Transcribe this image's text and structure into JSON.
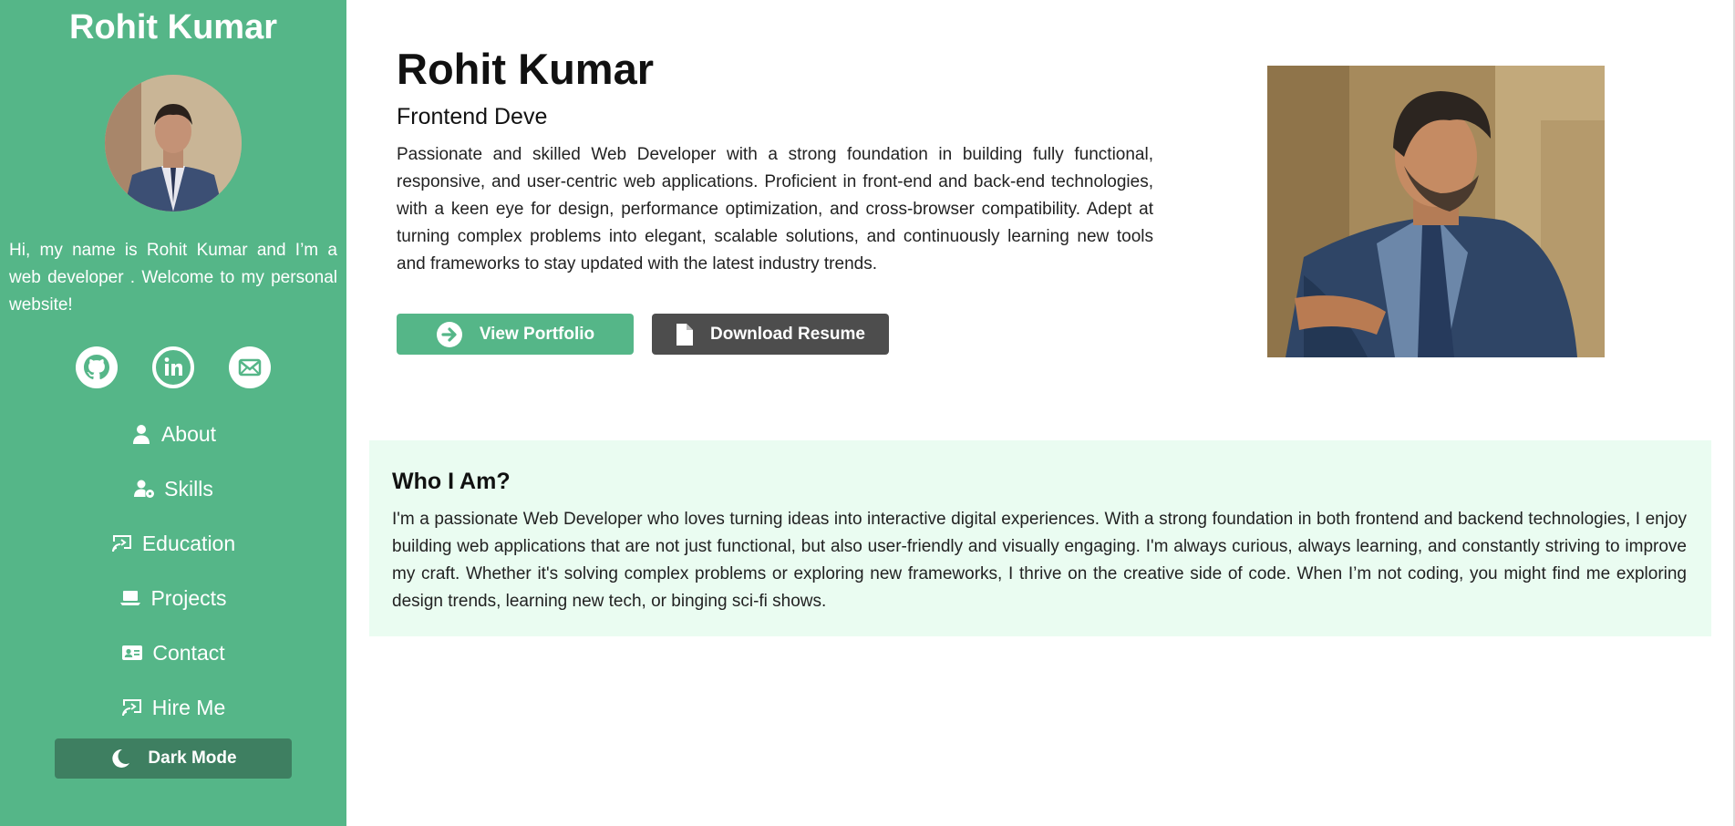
{
  "sidebar": {
    "name": "Rohit Kumar",
    "intro": "Hi, my name is Rohit Kumar and I’m a web developer . Welcome to my personal website!",
    "socials": [
      "github-icon",
      "linkedin-icon",
      "mail-icon"
    ],
    "nav": [
      {
        "label": "About",
        "icon": "user-icon"
      },
      {
        "label": "Skills",
        "icon": "user-gear-icon"
      },
      {
        "label": "Education",
        "icon": "chalkboard-icon"
      },
      {
        "label": "Projects",
        "icon": "laptop-icon"
      },
      {
        "label": "Contact",
        "icon": "address-card-icon"
      },
      {
        "label": "Hire Me",
        "icon": "chalkboard-icon"
      }
    ],
    "dark_mode_label": "Dark Mode"
  },
  "hero": {
    "name": "Rohit Kumar",
    "role": "Frontend Deve",
    "description": "Passionate and skilled Web Developer with a strong foundation in building fully functional, responsive, and user-centric web applications. Proficient in front-end and back-end technologies, with a keen eye for design, performance optimization, and cross-browser compatibility. Adept at turning complex problems into elegant, scalable solutions, and continuously learning new tools and frameworks to stay updated with the latest industry trends.",
    "portfolio_button": "View Portfolio",
    "resume_button": "Download Resume"
  },
  "about": {
    "title": "Who I Am?",
    "text": "I'm a passionate Web Developer who loves turning ideas into interactive digital experiences. With a strong foundation in both frontend and backend technologies, I enjoy building web applications that are not just functional, but also user-friendly and visually engaging. I'm always curious, always learning, and constantly striving to improve my craft. Whether it's solving complex problems or exploring new frameworks, I thrive on the creative side of code. When I’m not coding, you might find me exploring design trends, learning new tech, or binging sci-fi shows."
  },
  "colors": {
    "sidebar": "#55b688",
    "dark_button": "#3e7f61",
    "resume_button": "#4d4d4d",
    "about_bg": "#eafcf1"
  }
}
